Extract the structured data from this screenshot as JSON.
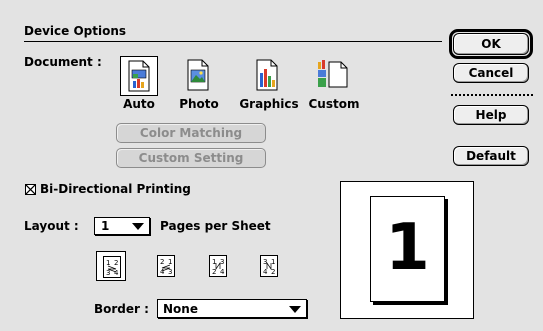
{
  "section": {
    "title": "Device Options"
  },
  "buttons": {
    "ok": "OK",
    "cancel": "Cancel",
    "help": "Help",
    "default": "Default"
  },
  "document": {
    "label": "Document :",
    "types": [
      {
        "label": "Auto",
        "icon": "auto-document-icon",
        "selected": true
      },
      {
        "label": "Photo",
        "icon": "photo-document-icon",
        "selected": false
      },
      {
        "label": "Graphics",
        "icon": "graphics-document-icon",
        "selected": false
      },
      {
        "label": "Custom",
        "icon": "custom-document-icon",
        "selected": false
      }
    ]
  },
  "color_matching": {
    "label": "Color Matching",
    "enabled": false
  },
  "custom_setting": {
    "label": "Custom Setting",
    "enabled": false
  },
  "bidirectional": {
    "label": "Bi-Directional Printing",
    "checked": true
  },
  "layout": {
    "label": "Layout :",
    "value": "1",
    "suffix": "Pages per Sheet",
    "orders": [
      {
        "icon": "layout-order-1-icon",
        "selected": true,
        "cells": [
          "1",
          "2",
          "3",
          "4"
        ]
      },
      {
        "icon": "layout-order-2-icon",
        "selected": false,
        "cells": [
          "2",
          "1",
          "4",
          "3"
        ]
      },
      {
        "icon": "layout-order-3-icon",
        "selected": false,
        "cells": [
          "1",
          "3",
          "2",
          "4"
        ]
      },
      {
        "icon": "layout-order-4-icon",
        "selected": false,
        "cells": [
          "3",
          "1",
          "4",
          "2"
        ]
      }
    ]
  },
  "border": {
    "label": "Border :",
    "value": "None"
  },
  "preview": {
    "page_number": "1"
  }
}
